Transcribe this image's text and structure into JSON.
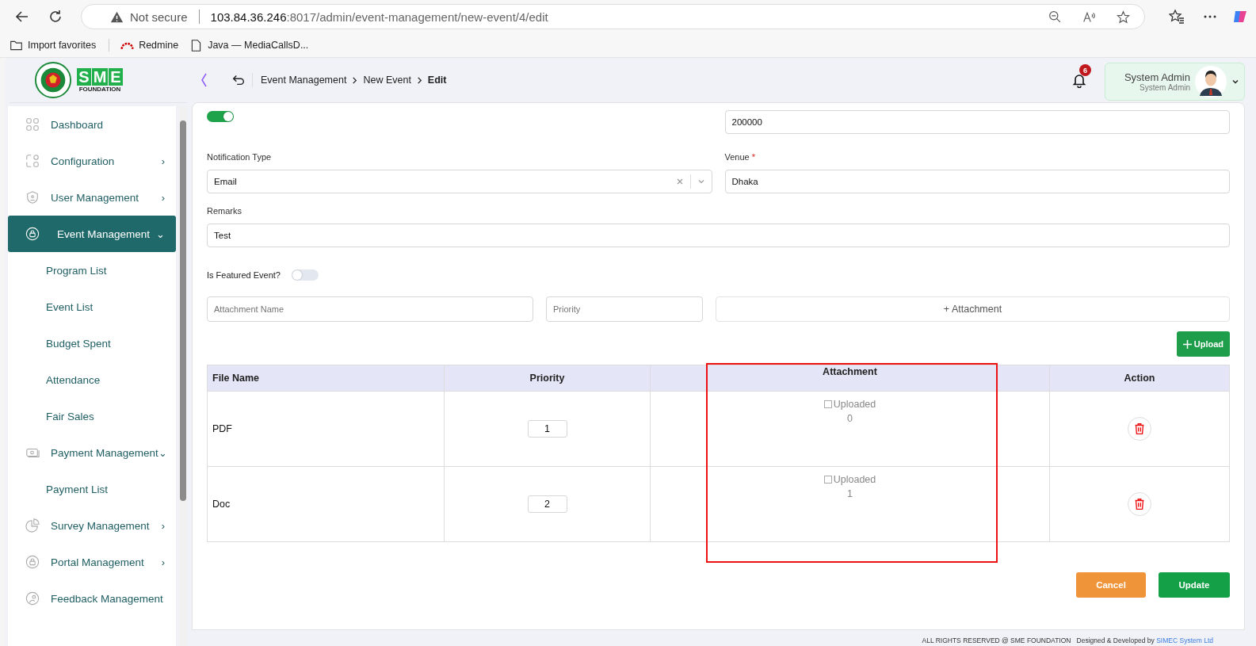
{
  "browser": {
    "security": "Not secure",
    "url_host": "103.84.36.246",
    "url_rest": ":8017/admin/event-management/new-event/4/edit",
    "bookmarks": [
      {
        "kind": "folder",
        "label": "Import favorites"
      },
      {
        "kind": "redmine",
        "label": "Redmine"
      },
      {
        "kind": "page",
        "label": "Java — MediaCallsD..."
      }
    ]
  },
  "logo": {
    "letters": [
      "S",
      "M",
      "E"
    ],
    "subtitle": "FOUNDATION"
  },
  "breadcrumb": [
    {
      "label": "Event Management",
      "current": false
    },
    {
      "label": "New Event",
      "current": false
    },
    {
      "label": "Edit",
      "current": true
    }
  ],
  "notifications": {
    "count": "6"
  },
  "user": {
    "name": "System Admin",
    "role": "System Admin"
  },
  "sidebar": {
    "items": [
      {
        "kind": "grid",
        "label": "Dashboard",
        "selected": false
      },
      {
        "kind": "config",
        "label": "Configuration",
        "arrow": "›",
        "selected": false
      },
      {
        "kind": "shield",
        "label": "User Management",
        "arrow": "›",
        "selected": false
      },
      {
        "kind": "lock",
        "label": "Event Management",
        "arrow": "⌄",
        "selected": true
      },
      {
        "kind": "sub",
        "label": "Program List",
        "selected": false
      },
      {
        "kind": "sub",
        "label": "Event List",
        "selected": false
      },
      {
        "kind": "sub",
        "label": "Budget Spent",
        "selected": false
      },
      {
        "kind": "sub",
        "label": "Attendance",
        "selected": false
      },
      {
        "kind": "sub",
        "label": "Fair Sales",
        "selected": false
      },
      {
        "kind": "money",
        "label": "Payment Management",
        "arrow": "⌄",
        "selected": false
      },
      {
        "kind": "sub",
        "label": "Payment List",
        "selected": false
      },
      {
        "kind": "pie",
        "label": "Survey Management",
        "arrow": "›",
        "selected": false
      },
      {
        "kind": "lock",
        "label": "Portal Management",
        "arrow": "›",
        "selected": false
      },
      {
        "kind": "person",
        "label": "Feedback Management",
        "selected": false
      }
    ]
  },
  "form": {
    "active_toggle": {
      "on": true
    },
    "amount": {
      "value": "200000"
    },
    "notification_type": {
      "label": "Notification Type",
      "value": "Email"
    },
    "venue": {
      "label": "Venue",
      "required_mark": "*",
      "value": "Dhaka"
    },
    "remarks": {
      "label": "Remarks",
      "value": "Test"
    },
    "featured": {
      "label": "Is Featured Event?",
      "on": false
    },
    "attachment_name": {
      "placeholder": "Attachment Name"
    },
    "priority": {
      "placeholder": "Priority"
    },
    "attach_button": "+ Attachment",
    "upload_button": "Upload"
  },
  "table": {
    "columns": [
      "File Name",
      "Priority",
      "Attachment",
      "Action"
    ],
    "rows": [
      {
        "file_name": "PDF",
        "priority": "1",
        "attachment": "Uploaded",
        "index": "0"
      },
      {
        "file_name": "Doc",
        "priority": "2",
        "attachment": "Uploaded",
        "index": "1"
      }
    ]
  },
  "annotations": [
    {
      "kind": "rectangle"
    }
  ],
  "buttons": [
    {
      "kind": "cancel",
      "label": "Cancel"
    },
    {
      "kind": "update",
      "label": "Update"
    }
  ],
  "footer": {
    "text": "ALL RIGHTS RESERVED @ SME FOUNDATION",
    "credit": "Designed & Developed by",
    "link": "SIMEC System Ltd"
  }
}
